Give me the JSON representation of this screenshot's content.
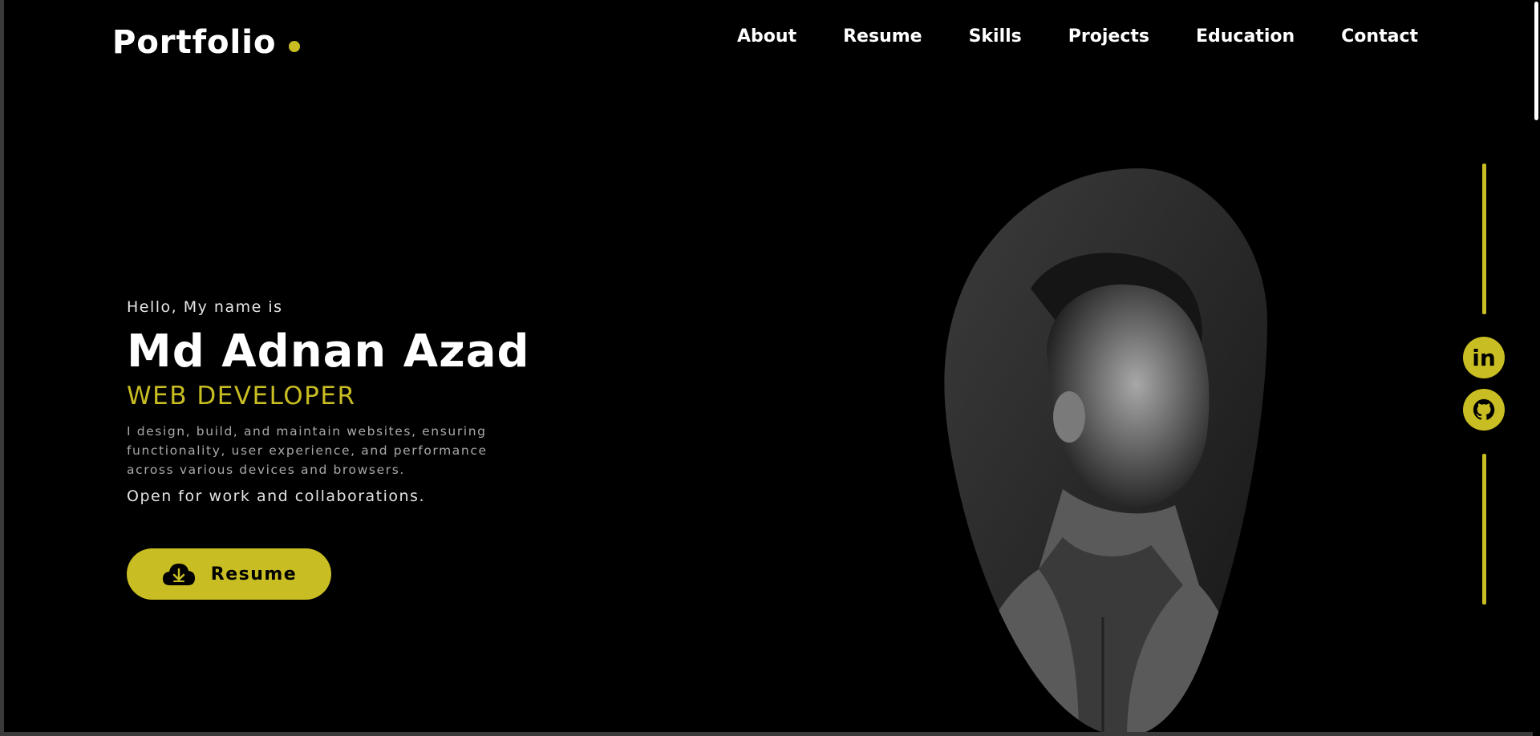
{
  "header": {
    "logo": "Portfolio",
    "nav": [
      "About",
      "Resume",
      "Skills",
      "Projects",
      "Education",
      "Contact"
    ]
  },
  "hero": {
    "greeting": "Hello, My name is",
    "name": "Md Adnan Azad",
    "role": "WEB DEVELOPER",
    "description": "I design, build, and maintain websites, ensuring functionality, user experience, and performance across various devices and browsers.",
    "availability": "Open for work and collaborations.",
    "resume_button": "Resume"
  },
  "social": {
    "linkedin": "in",
    "github_icon": "github-icon"
  },
  "colors": {
    "accent": "#c8bd22",
    "background": "#000000",
    "text": "#ffffff"
  }
}
